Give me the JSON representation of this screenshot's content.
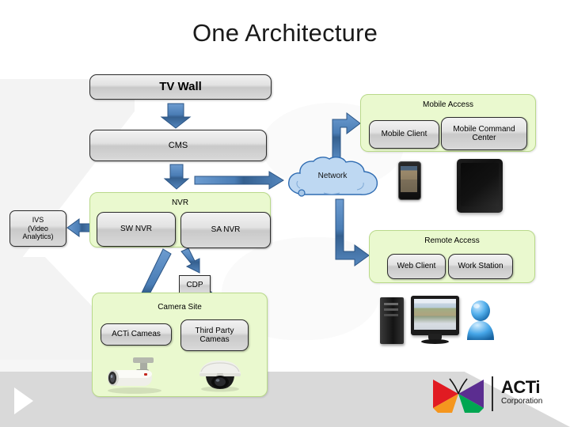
{
  "slide": {
    "title": "One Architecture"
  },
  "nodes": {
    "tv_wall": "TV Wall",
    "cms": "CMS",
    "nvr_group": "NVR",
    "sw_nvr": "SW NVR",
    "sa_nvr": "SA NVR",
    "ivs": "IVS (Video Analytics)",
    "ivs_line1": "IVS",
    "ivs_line2": "(Video",
    "ivs_line3": "Analytics)",
    "cdp": "CDP",
    "camera_site": "Camera Site",
    "acti_cameras": "ACTi Cameas",
    "third_party_line1": "Third Party",
    "third_party_line2": "Cameas",
    "network": "Network",
    "mobile_access": "Mobile Access",
    "mobile_client": "Mobile Client",
    "mobile_command_line1": "Mobile Command",
    "mobile_command_line2": "Center",
    "remote_access": "Remote Access",
    "web_client": "Web Client",
    "work_station": "Work Station"
  },
  "logo": {
    "brand": "ACTi",
    "sub": "Corporation"
  },
  "colors": {
    "green_fill": "#eaf9cf",
    "green_border": "#b9d98a",
    "arrow_blue": "#3f72ad",
    "arrow_blue_dark": "#2c5585",
    "cloud_fill": "#bcd6f0",
    "cloud_border": "#2e6bb0",
    "bottom_band": "#d9d9d9",
    "logo_red": "#e11b22",
    "logo_purple": "#5b2d90",
    "logo_orange": "#f5961e",
    "logo_green": "#00a651"
  },
  "icons": {
    "network_cloud": "cloud-icon",
    "smartphone": "smartphone-icon",
    "tablet": "tablet-icon",
    "pc_tower": "pc-tower-icon",
    "monitor": "monitor-icon",
    "user_avatar": "user-avatar-icon",
    "bullet_camera": "bullet-camera-icon",
    "dome_camera": "dome-camera-icon",
    "play_triangle": "play-triangle-icon",
    "butterfly_logo": "acti-butterfly-logo-icon"
  },
  "connections": [
    {
      "from": "TV Wall",
      "to": "CMS",
      "direction": "down"
    },
    {
      "from": "CMS",
      "to": "NVR",
      "direction": "down"
    },
    {
      "from": "CMS",
      "to": "Network",
      "direction": "right"
    },
    {
      "from": "Network",
      "to": "Mobile Access",
      "direction": "up-right"
    },
    {
      "from": "Network",
      "to": "Remote Access",
      "direction": "down-right"
    },
    {
      "from": "SW NVR",
      "to": "IVS (Video Analytics)",
      "direction": "left"
    },
    {
      "from": "NVR",
      "to": "ACTi Cameas",
      "direction": "down-left"
    },
    {
      "from": "NVR",
      "to": "CDP",
      "direction": "down-right"
    },
    {
      "from": "CDP",
      "to": "Third Party Cameas",
      "direction": "down-right"
    }
  ]
}
